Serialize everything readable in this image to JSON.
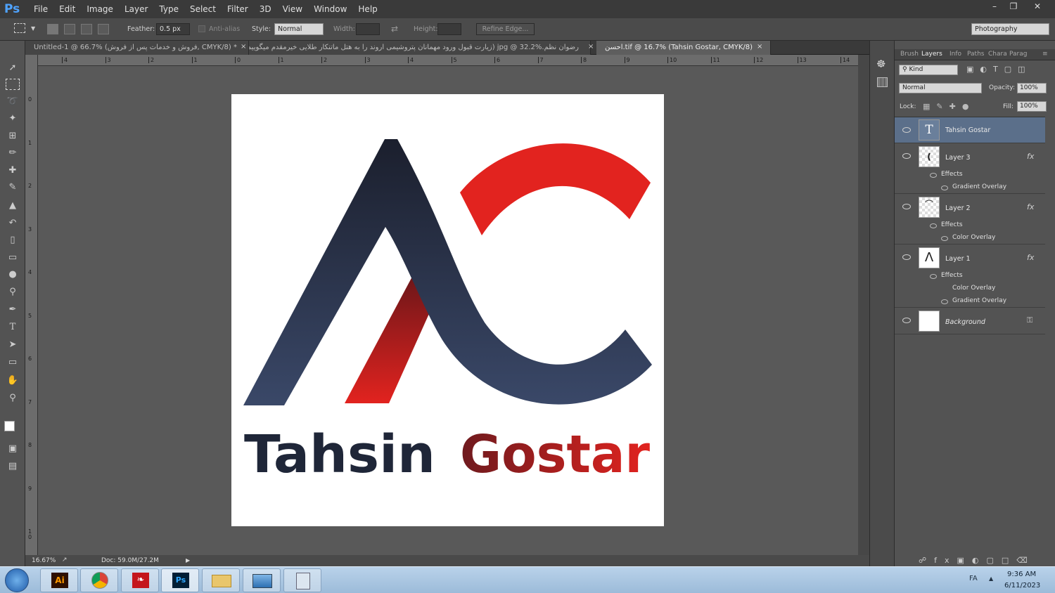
{
  "app": {
    "logo": "Ps"
  },
  "menu": [
    "File",
    "Edit",
    "Image",
    "Layer",
    "Type",
    "Select",
    "Filter",
    "3D",
    "View",
    "Window",
    "Help"
  ],
  "options": {
    "feather_label": "Feather:",
    "feather_value": "0.5 px",
    "antialias_label": "Anti-alias",
    "style_label": "Style:",
    "style_value": "Normal",
    "width_label": "Width:",
    "height_label": "Height:",
    "refine_edge": "Refine Edge...",
    "workspace": "Photography"
  },
  "tabs": [
    {
      "label": "Untitled-1 @ 66.7% (فروش و خدمات پس از فروش, CMYK/8) *"
    },
    {
      "label": "رضوان نظم.jpg @ 32.2% (زیارت قبول ورود مهمانان پتروشیمی اروند را به هتل ماتنکار طلایی خیرمقدم میگوییم, CMYK/8) *"
    },
    {
      "label": "احسن.tif @ 16.7% (Tahsin Gostar, CMYK/8)"
    }
  ],
  "ruler_h": [
    "4",
    "3",
    "2",
    "1",
    "0",
    "1",
    "2",
    "3",
    "4",
    "5",
    "6",
    "7",
    "8",
    "9",
    "10",
    "11",
    "12",
    "13",
    "14"
  ],
  "ruler_v": [
    "0",
    "1",
    "2",
    "3",
    "4",
    "5",
    "6",
    "7",
    "8",
    "9",
    "1 0"
  ],
  "status": {
    "zoom": "16.67%",
    "doc": "Doc: 59.0M/27.2M"
  },
  "logo": {
    "word1": "Tahsin",
    "word2": "Gostar"
  },
  "colors": {
    "navy": "#1f2638",
    "red": "#e2231f",
    "dark_red": "#8e1b1d",
    "accent": "#4fa3ff"
  },
  "panel": {
    "tabs": [
      "Brush",
      "Layers",
      "Info",
      "Paths",
      "Chara",
      "Parag"
    ],
    "kind_label": "Kind",
    "blend_mode": "Normal",
    "opacity_label": "Opacity:",
    "opacity_value": "100%",
    "lock_label": "Lock:",
    "fill_label": "Fill:",
    "fill_value": "100%",
    "layers": [
      {
        "name": "Tahsin Gostar"
      },
      {
        "name": "Layer 3",
        "effects_label": "Effects",
        "fx": [
          "Gradient Overlay"
        ]
      },
      {
        "name": "Layer 2",
        "effects_label": "Effects",
        "fx": [
          "Color Overlay"
        ]
      },
      {
        "name": "Layer 1",
        "effects_label": "Effects",
        "fx": [
          "Color Overlay",
          "Gradient Overlay"
        ]
      },
      {
        "name": "Background"
      }
    ]
  },
  "taskbar": {
    "lang": "FA",
    "time": "9:36 AM",
    "date": "6/11/2023"
  }
}
